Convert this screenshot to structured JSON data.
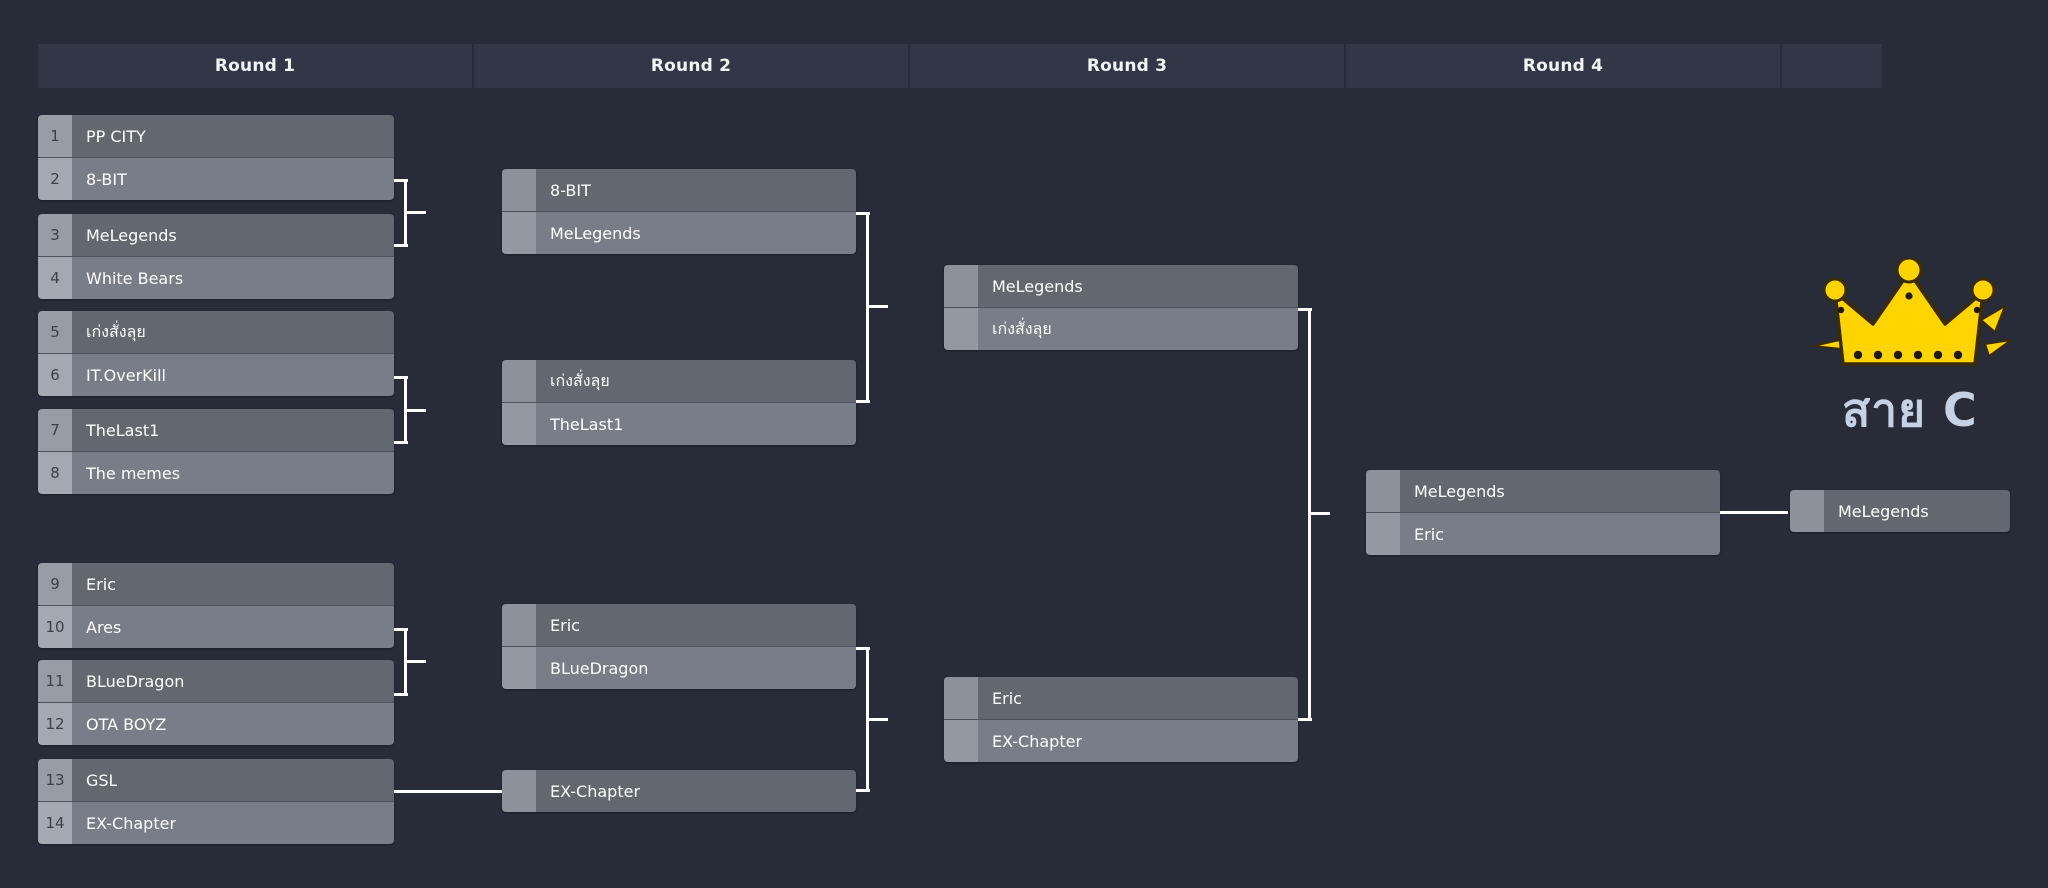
{
  "app": {
    "background_color": "#282c38",
    "box_color": "#636771",
    "line_color": "#ffffff",
    "crown_color": "#ffd400",
    "caption_color": "#c6d2e4"
  },
  "headers": [
    {
      "label": "Round 1"
    },
    {
      "label": "Round 2"
    },
    {
      "label": "Round 3"
    },
    {
      "label": "Round 4"
    },
    {
      "label": ""
    }
  ],
  "round1": [
    {
      "slots": [
        {
          "seed": "1",
          "team": "PP CITY"
        },
        {
          "seed": "2",
          "team": "8-BIT"
        }
      ]
    },
    {
      "slots": [
        {
          "seed": "3",
          "team": "MeLegends"
        },
        {
          "seed": "4",
          "team": "White Bears"
        }
      ]
    },
    {
      "slots": [
        {
          "seed": "5",
          "team": "เก่งสั่งลุย"
        },
        {
          "seed": "6",
          "team": "IT.OverKill"
        }
      ]
    },
    {
      "slots": [
        {
          "seed": "7",
          "team": "TheLast1"
        },
        {
          "seed": "8",
          "team": "The memes"
        }
      ]
    },
    {
      "slots": [
        {
          "seed": "9",
          "team": "Eric"
        },
        {
          "seed": "10",
          "team": "Ares"
        }
      ]
    },
    {
      "slots": [
        {
          "seed": "11",
          "team": "BLueDragon"
        },
        {
          "seed": "12",
          "team": "OTA BOYZ"
        }
      ]
    },
    {
      "slots": [
        {
          "seed": "13",
          "team": "GSL"
        },
        {
          "seed": "14",
          "team": "EX-Chapter"
        }
      ]
    }
  ],
  "round2": [
    {
      "slots": [
        {
          "team": "8-BIT"
        },
        {
          "team": "MeLegends"
        }
      ]
    },
    {
      "slots": [
        {
          "team": "เก่งสั่งลุย"
        },
        {
          "team": "TheLast1"
        }
      ]
    },
    {
      "slots": [
        {
          "team": "Eric"
        },
        {
          "team": "BLueDragon"
        }
      ]
    },
    {
      "slots": [
        {
          "team": "EX-Chapter"
        }
      ]
    }
  ],
  "round3": [
    {
      "slots": [
        {
          "team": "MeLegends"
        },
        {
          "team": "เก่งสั่งลุย"
        }
      ]
    },
    {
      "slots": [
        {
          "team": "Eric"
        },
        {
          "team": "EX-Chapter"
        }
      ]
    }
  ],
  "round4": [
    {
      "slots": [
        {
          "team": "MeLegends"
        },
        {
          "team": "Eric"
        }
      ]
    }
  ],
  "champion": {
    "slots": [
      {
        "team": "MeLegends"
      }
    ]
  },
  "crown": {
    "icon": "crown-icon",
    "caption": "สาย C"
  }
}
